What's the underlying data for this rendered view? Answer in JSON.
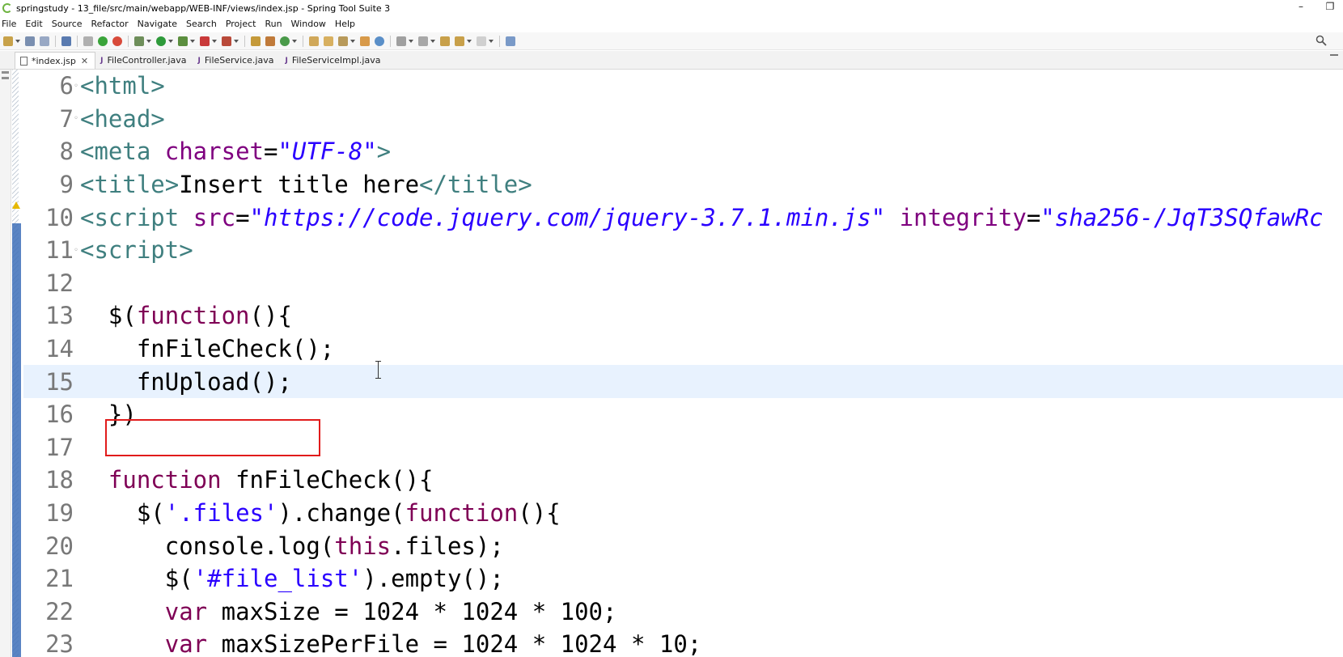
{
  "window": {
    "title": "springstudy - 13_file/src/main/webapp/WEB-INF/views/index.jsp - Spring Tool Suite 3",
    "minimize_glyph": "–",
    "restore_glyph": "❐"
  },
  "menu": [
    "File",
    "Edit",
    "Source",
    "Refactor",
    "Navigate",
    "Search",
    "Project",
    "Run",
    "Window",
    "Help"
  ],
  "tabs": [
    {
      "label": "*index.jsp",
      "active": true,
      "icon": "jsp-file-icon",
      "close": "✕"
    },
    {
      "label": "FileController.java",
      "active": false,
      "icon": "java-file-icon"
    },
    {
      "label": "FileService.java",
      "active": false,
      "icon": "java-file-icon"
    },
    {
      "label": "FileServiceImpl.java",
      "active": false,
      "icon": "java-file-icon"
    }
  ],
  "editor": {
    "current_line": "15",
    "lines": [
      {
        "num": "6",
        "fold": "◦",
        "seg": [
          [
            "tag",
            "<html>"
          ]
        ]
      },
      {
        "num": "7",
        "fold": "◦",
        "seg": [
          [
            "tag",
            "<head>"
          ]
        ]
      },
      {
        "num": "8",
        "fold": "",
        "seg": [
          [
            "tag",
            "<meta "
          ],
          [
            "attr",
            "charset"
          ],
          [
            "plain",
            "="
          ],
          [
            "str",
            "\"UTF-8\""
          ],
          [
            "tag",
            ">"
          ]
        ]
      },
      {
        "num": "9",
        "fold": "",
        "seg": [
          [
            "tag",
            "<title>"
          ],
          [
            "plain",
            "Insert title here"
          ],
          [
            "tag",
            "</title>"
          ]
        ]
      },
      {
        "num": "10",
        "fold": "",
        "seg": [
          [
            "tag",
            "<script "
          ],
          [
            "attr",
            "src"
          ],
          [
            "plain",
            "="
          ],
          [
            "str",
            "\"https://code.jquery.com/jquery-3.7.1.min.js\" "
          ],
          [
            "attr",
            "integrity"
          ],
          [
            "plain",
            "="
          ],
          [
            "str",
            "\"sha256-/JqT3SQfawRc"
          ]
        ]
      },
      {
        "num": "11",
        "fold": "◦",
        "seg": [
          [
            "tag",
            "<script>"
          ]
        ]
      },
      {
        "num": "12",
        "fold": "",
        "seg": [
          [
            "plain",
            ""
          ]
        ]
      },
      {
        "num": "13",
        "fold": "",
        "seg": [
          [
            "plain",
            "  $("
          ],
          [
            "kw",
            "function"
          ],
          [
            "plain",
            "(){"
          ]
        ]
      },
      {
        "num": "14",
        "fold": "",
        "seg": [
          [
            "plain",
            "    fnFileCheck();"
          ]
        ]
      },
      {
        "num": "15",
        "fold": "",
        "seg": [
          [
            "plain",
            "    fnUpload();"
          ]
        ]
      },
      {
        "num": "16",
        "fold": "",
        "seg": [
          [
            "plain",
            "  })"
          ]
        ]
      },
      {
        "num": "17",
        "fold": "",
        "seg": [
          [
            "plain",
            ""
          ]
        ]
      },
      {
        "num": "18",
        "fold": "",
        "seg": [
          [
            "plain",
            "  "
          ],
          [
            "kw",
            "function"
          ],
          [
            "plain",
            " fnFileCheck(){"
          ]
        ]
      },
      {
        "num": "19",
        "fold": "",
        "seg": [
          [
            "plain",
            "    $("
          ],
          [
            "jstr",
            "'.files'"
          ],
          [
            "plain",
            ").change("
          ],
          [
            "kw",
            "function"
          ],
          [
            "plain",
            "(){"
          ]
        ]
      },
      {
        "num": "20",
        "fold": "",
        "seg": [
          [
            "plain",
            "      console.log("
          ],
          [
            "kw",
            "this"
          ],
          [
            "plain",
            ".files);"
          ]
        ]
      },
      {
        "num": "21",
        "fold": "",
        "seg": [
          [
            "plain",
            "      $("
          ],
          [
            "jstr",
            "'#file_list'"
          ],
          [
            "plain",
            ").empty();"
          ]
        ]
      },
      {
        "num": "22",
        "fold": "",
        "seg": [
          [
            "plain",
            "      "
          ],
          [
            "kw",
            "var"
          ],
          [
            "plain",
            " maxSize = 1024 * 1024 * 100;"
          ]
        ]
      },
      {
        "num": "23",
        "fold": "",
        "seg": [
          [
            "plain",
            "      "
          ],
          [
            "kw",
            "var"
          ],
          [
            "plain",
            " maxSizePerFile = 1024 * 1024 * 10;"
          ]
        ]
      }
    ]
  },
  "colors": {
    "tag": "#3f7f7f",
    "attribute": "#7f007f",
    "string": "#2a00ff",
    "keyword": "#7f0055",
    "current_line_bg": "#e8f2fe",
    "annotation_box": "#e11b1b"
  }
}
